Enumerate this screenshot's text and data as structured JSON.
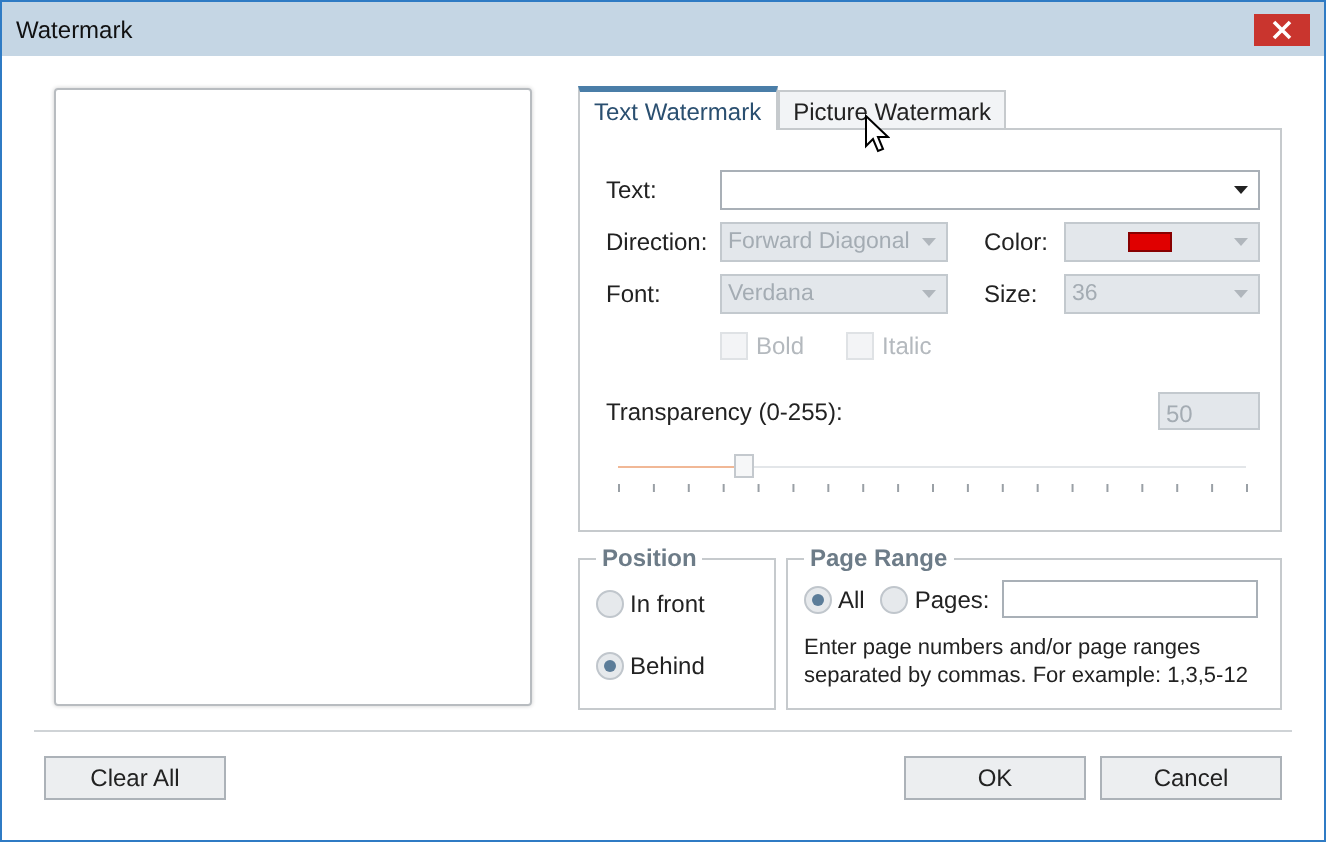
{
  "window": {
    "title": "Watermark"
  },
  "tabs": [
    {
      "label": "Text Watermark",
      "selected": true
    },
    {
      "label": "Picture Watermark",
      "selected": false
    }
  ],
  "text": {
    "label": "Text:"
  },
  "direction": {
    "label": "Direction:",
    "value": "Forward Diagonal",
    "disabled": true
  },
  "color": {
    "label": "Color:",
    "color": "#e00000",
    "disabled": true
  },
  "font": {
    "label": "Font:",
    "value": "Verdana",
    "disabled": true
  },
  "size": {
    "label": "Size:",
    "value": "36",
    "disabled": true
  },
  "styles": [
    {
      "label": "Bold",
      "checked": false,
      "disabled": true
    },
    {
      "label": "Italic",
      "checked": false,
      "disabled": true
    }
  ],
  "transparency": {
    "label": "Transparency (0-255):",
    "value": "50",
    "disabled": true,
    "level": 0.2
  },
  "position": {
    "title": "Position",
    "options": [
      {
        "label": "In front",
        "selected": false
      },
      {
        "label": "Behind",
        "selected": true
      }
    ]
  },
  "page_range": {
    "title": "Page Range",
    "options": [
      {
        "label": "All",
        "selected": true
      },
      {
        "label": "Pages:",
        "selected": false
      }
    ],
    "hint": "Enter page numbers and/or page ranges separated by commas. For example: 1,3,5-12"
  },
  "buttons": [
    {
      "label": "Clear All"
    },
    {
      "label": "OK"
    },
    {
      "label": "Cancel"
    }
  ]
}
